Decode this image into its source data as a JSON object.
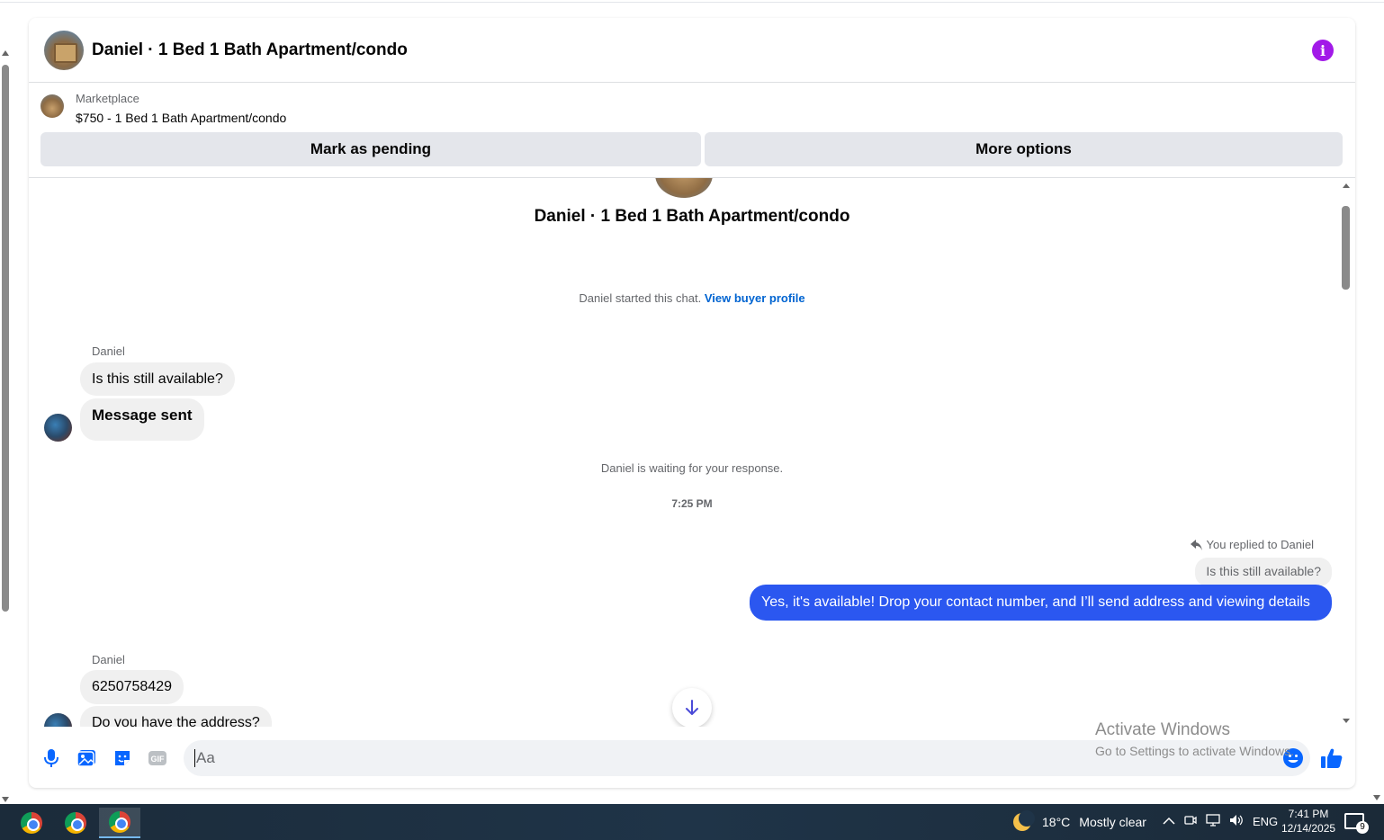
{
  "header": {
    "title": "Daniel · 1 Bed 1 Bath Apartment/condo",
    "info_icon": "info-icon"
  },
  "listing": {
    "label": "Marketplace",
    "price_title": "$750 - 1 Bed 1 Bath Apartment/condo",
    "mark_pending": "Mark as pending",
    "more_options": "More options"
  },
  "conversation": {
    "title": "Daniel · 1 Bed 1 Bath Apartment/condo",
    "started_text": "Daniel started this chat.",
    "view_profile": "View buyer profile",
    "group1": {
      "sender": "Daniel",
      "msg1": "Is this still available?",
      "msg2": "Message sent"
    },
    "waiting": "Daniel is waiting for your response.",
    "time": "7:25 PM",
    "reply": {
      "replied_to": "You replied to Daniel",
      "quoted": "Is this still available?",
      "message": "Yes, it's available! Drop your contact number, and I’ll send address and viewing details"
    },
    "group2": {
      "sender": "Daniel",
      "msg1": "6250758429",
      "msg2": "Do you have the address?"
    }
  },
  "composer": {
    "placeholder": "Aa",
    "gif_label": "GIF"
  },
  "watermark": {
    "line1": "Activate Windows",
    "line2": "Go to Settings to activate Windows."
  },
  "taskbar": {
    "weather_temp": "18°C",
    "weather_desc": "Mostly clear",
    "lang": "ENG",
    "time": "7:41 PM",
    "date": "12/14/2025",
    "notif_count": "9"
  },
  "colors": {
    "accent_blue": "#2b57f0",
    "link": "#0064d1",
    "info_purple": "#a21ae8"
  }
}
